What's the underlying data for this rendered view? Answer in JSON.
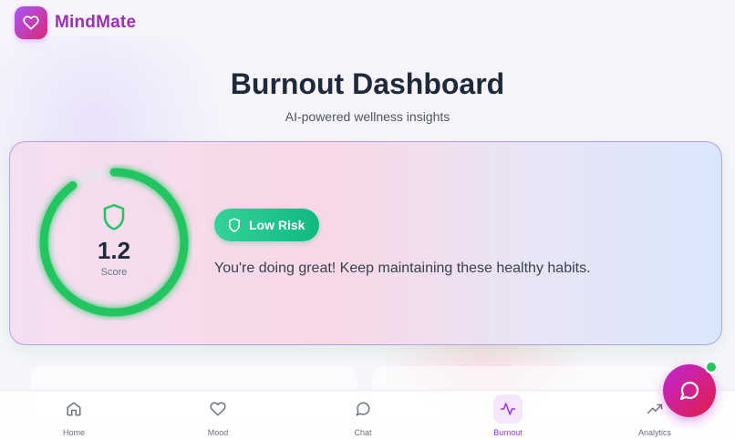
{
  "app": {
    "brand": "MindMate",
    "logo_icon": "heart-icon"
  },
  "page": {
    "title": "Burnout Dashboard",
    "subtitle": "AI-powered wellness insights"
  },
  "score_card": {
    "score": "1.2",
    "score_label": "Score",
    "gauge_fraction": 0.9,
    "risk_badge": "Low Risk",
    "message": "You're doing great! Keep maintaining these healthy habits.",
    "colors": {
      "gauge": "#22c55e",
      "badge": "#10b981"
    }
  },
  "nav": {
    "items": [
      {
        "label": "Home",
        "icon": "home-icon"
      },
      {
        "label": "Mood",
        "icon": "heart-icon"
      },
      {
        "label": "Chat",
        "icon": "chat-bubble-icon"
      },
      {
        "label": "Burnout",
        "icon": "activity-icon",
        "active": true
      },
      {
        "label": "Analytics",
        "icon": "trending-up-icon"
      }
    ]
  },
  "fab": {
    "icon": "chat-bubble-icon",
    "status_color": "#22c55e"
  },
  "colors": {
    "brand": "#9d2fb5",
    "accent_gradient": [
      "#a855f7",
      "#db2777"
    ]
  }
}
